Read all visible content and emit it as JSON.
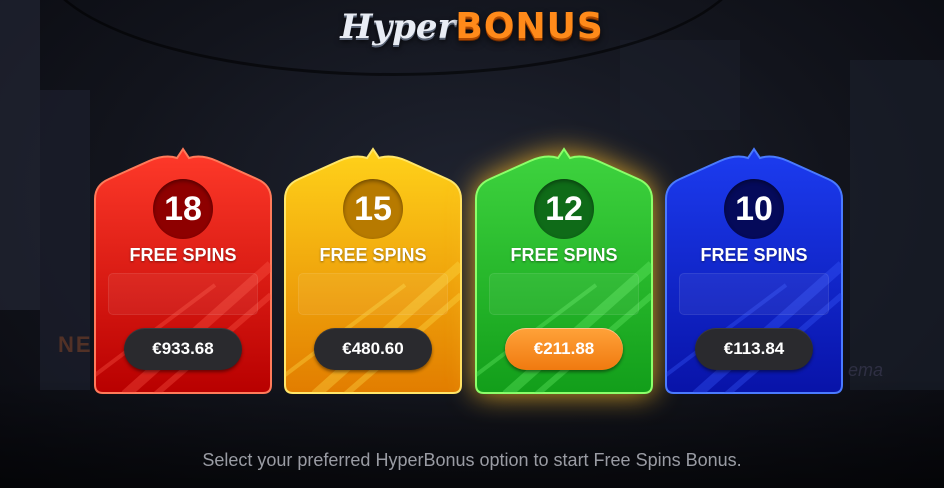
{
  "logo": {
    "part1": "Hyper",
    "part2": "BONUS"
  },
  "options": [
    {
      "spins": "18",
      "label": "FREE SPINS",
      "price": "€933.68",
      "theme": "red",
      "selected": false
    },
    {
      "spins": "15",
      "label": "FREE SPINS",
      "price": "€480.60",
      "theme": "yellow",
      "selected": false
    },
    {
      "spins": "12",
      "label": "FREE SPINS",
      "price": "€211.88",
      "theme": "green",
      "selected": true
    },
    {
      "spins": "10",
      "label": "FREE SPINS",
      "price": "€113.84",
      "theme": "blue",
      "selected": false
    }
  ],
  "themes": {
    "red": {
      "top": "#ff3a2a",
      "bottom": "#b80000",
      "stroke": "#ff7a5a",
      "circle": "#8e0000",
      "stripe": "#ff5a4a"
    },
    "yellow": {
      "top": "#ffd21a",
      "bottom": "#e27d00",
      "stroke": "#ffe66a",
      "circle": "#b77a00",
      "stripe": "#ffe04a"
    },
    "green": {
      "top": "#3fd43f",
      "bottom": "#129e1a",
      "stroke": "#8cff6a",
      "circle": "#0f6b18",
      "stripe": "#6cf06c"
    },
    "blue": {
      "top": "#1c3cf0",
      "bottom": "#0813a8",
      "stroke": "#4a7aff",
      "circle": "#050a5a",
      "stripe": "#3a5cff"
    }
  },
  "footer": {
    "instruction": "Select your preferred HyperBonus option to start Free Spins Bonus."
  }
}
